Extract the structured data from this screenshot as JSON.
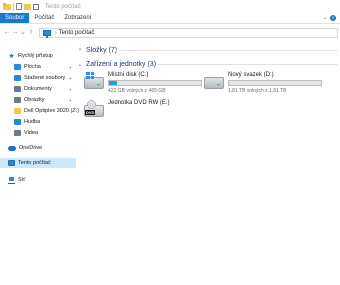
{
  "window": {
    "title": "Tento počítač"
  },
  "ribbon": {
    "tabs": [
      "Soubor",
      "Počítač",
      "Zobrazení"
    ],
    "help": "?"
  },
  "address": {
    "path": "Tento počítač"
  },
  "sidebar": {
    "quick_access": "Rychlý přístup",
    "items": [
      {
        "label": "Plocha",
        "icon": "desktop-icon",
        "color": "#2b88d8"
      },
      {
        "label": "Stažené soubory",
        "icon": "downloads-icon",
        "color": "#2b88d8"
      },
      {
        "label": "Dokumenty",
        "icon": "documents-icon",
        "color": "#6b7b8c"
      },
      {
        "label": "Obrázky",
        "icon": "pictures-icon",
        "color": "#6b7b8c"
      },
      {
        "label": "Dell Optiplex 3020 (Z:)",
        "icon": "folder-icon",
        "color": "#f2c94c"
      },
      {
        "label": "Hudba",
        "icon": "music-icon",
        "color": "#2b88d8"
      },
      {
        "label": "Videa",
        "icon": "video-icon",
        "color": "#6b7b8c"
      }
    ],
    "onedrive": "OneDrive",
    "this_pc": "Tento počítač",
    "network": "Síť"
  },
  "main": {
    "folders_header": "Složky (7)",
    "devices_header": "Zařízení a jednotky (3)",
    "drives": [
      {
        "name": "Místní disk (C:)",
        "free": "422 GB volných z 465 GB",
        "used_fraction": 0.09,
        "icon": "system-drive-icon"
      },
      {
        "name": "Nový svazek (D:)",
        "free": "1,81 TB volných z 1,81 TB",
        "used_fraction": 0.0,
        "icon": "hard-drive-icon"
      },
      {
        "name": "Jednotka DVD RW (E:)",
        "icon": "dvd-drive-icon",
        "badge": "DVD"
      }
    ]
  },
  "colors": {
    "accent": "#1979ca",
    "selection": "#cce8ff",
    "bar_fill": "#26a0da",
    "header_text": "#1e3b70"
  }
}
